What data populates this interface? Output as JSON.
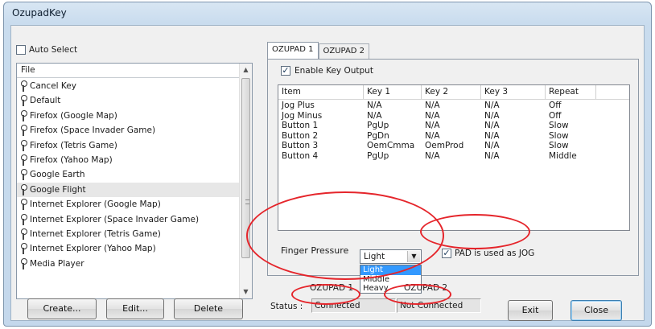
{
  "window": {
    "title": "OzupadKey"
  },
  "auto_select": {
    "label": "Auto Select",
    "checked": false
  },
  "file_list": {
    "header": "File",
    "items": [
      "Cancel Key",
      "Default",
      "Firefox (Google Map)",
      "Firefox (Space Invader Game)",
      "Firefox (Tetris Game)",
      "Firefox (Yahoo Map)",
      "Google Earth",
      "Google Flight",
      "Internet Explorer (Google Map)",
      "Internet Explorer (Space Invader Game)",
      "Internet Explorer (Tetris Game)",
      "Internet Explorer (Yahoo Map)",
      "Media Player"
    ],
    "selected": "Google Flight"
  },
  "buttons": {
    "create": "Create...",
    "edit": "Edit...",
    "delete": "Delete",
    "exit": "Exit",
    "close": "Close"
  },
  "tabs": [
    {
      "label": "OZUPAD 1",
      "active": true
    },
    {
      "label": "OZUPAD 2",
      "active": false
    }
  ],
  "enable_key_output": {
    "label": "Enable Key Output",
    "checked": true
  },
  "key_table": {
    "columns": [
      "Item",
      "Key 1",
      "Key 2",
      "Key 3",
      "Repeat"
    ],
    "rows": [
      [
        "Jog Plus",
        "N/A",
        "N/A",
        "N/A",
        "Off"
      ],
      [
        "Jog Minus",
        "N/A",
        "N/A",
        "N/A",
        "Off"
      ],
      [
        "Button 1",
        "PgUp",
        "N/A",
        "N/A",
        "Slow"
      ],
      [
        "Button 2",
        "PgDn",
        "N/A",
        "N/A",
        "Slow"
      ],
      [
        "Button 3",
        "OemCmma",
        "OemProd",
        "N/A",
        "Slow"
      ],
      [
        "Button 4",
        "PgUp",
        "N/A",
        "N/A",
        "Middle"
      ]
    ]
  },
  "finger_pressure": {
    "label": "Finger Pressure",
    "value": "Light",
    "options": [
      "Light",
      "Middle",
      "Heavy"
    ]
  },
  "pad_jog": {
    "label": "PAD is used as JOG",
    "checked": true
  },
  "status": {
    "label": "Status :",
    "pad1": {
      "name": "OZUPAD 1",
      "state": "Connected"
    },
    "pad2": {
      "name": "OZUPAD 2",
      "state": "Not Connected"
    }
  },
  "colors": {
    "annotation": "#e5252b",
    "highlight": "#3399ff"
  }
}
